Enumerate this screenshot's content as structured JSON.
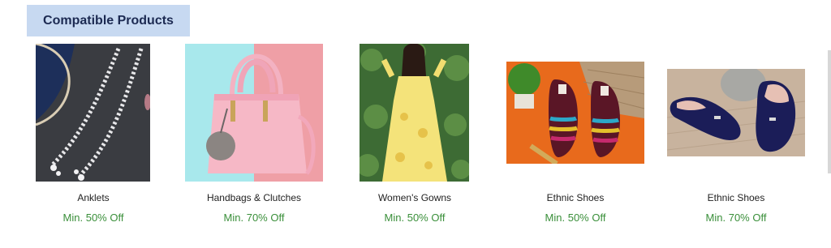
{
  "section": {
    "title": "Compatible Products"
  },
  "colors": {
    "offer_text": "#3a8f3a",
    "header_bg": "#c7d9f1"
  },
  "products": [
    {
      "name": "Anklets",
      "offer": "Min. 50% Off",
      "image_icon": "anklets-image"
    },
    {
      "name": "Handbags & Clutches",
      "offer": "Min. 70% Off",
      "image_icon": "handbag-image"
    },
    {
      "name": "Women's Gowns",
      "offer": "Min. 50% Off",
      "image_icon": "gown-image"
    },
    {
      "name": "Ethnic Shoes",
      "offer": "Min. 50% Off",
      "image_icon": "ethnic-shoes-image"
    },
    {
      "name": "Ethnic Shoes",
      "offer": "Min. 70% Off",
      "image_icon": "loafers-image"
    }
  ]
}
